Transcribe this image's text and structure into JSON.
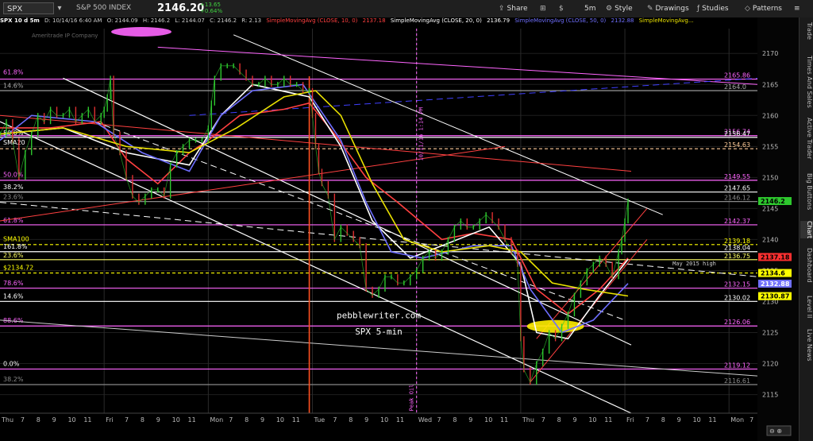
{
  "toolbar": {
    "symbol": "SPX",
    "description": "S&P 500 INDEX",
    "last": "2146.20",
    "change": "+13.65",
    "change_pct": "+0.64%",
    "share": "Share",
    "timeframe": "5m",
    "style": "Style",
    "drawings": "Drawings",
    "studies": "Studies",
    "patterns": "Patterns"
  },
  "studybar": {
    "header": "SPX 10 d 5m",
    "date": "D: 10/14/16 6:40 AM",
    "o": "O: 2144.09",
    "h": "H: 2146.2",
    "l": "L: 2144.07",
    "c": "C: 2146.2",
    "r": "R: 2.13",
    "sma10": "SimpleMovingAvg (CLOSE, 10, 0)",
    "sma10_v": "2137.18",
    "sma20": "SimpleMovingAvg (CLOSE, 20, 0)",
    "sma20_v": "2136.79",
    "sma50": "SimpleMovingAvg (CLOSE, 50, 0)",
    "sma50_v": "2132.88",
    "sma100": "SimpleMovingAvg..."
  },
  "sidebar": [
    "Trade",
    "Times And Sales",
    "Active Trader",
    "Big Buttons",
    "Chart",
    "Dashboard",
    "Level II",
    "Live News"
  ],
  "chart_data": {
    "type": "line",
    "ylim": [
      2112,
      2174
    ],
    "y_ticks": [
      2115,
      2120,
      2125,
      2130,
      2135,
      2140,
      2145,
      2150,
      2155,
      2160,
      2165,
      2170
    ],
    "x_labels": [
      {
        "t": "Thu",
        "x": 0
      },
      {
        "t": "7",
        "x": 6
      },
      {
        "t": "8",
        "x": 11
      },
      {
        "t": "9",
        "x": 16
      },
      {
        "t": "10",
        "x": 21
      },
      {
        "t": "11",
        "x": 26
      },
      {
        "t": "Fri",
        "x": 33
      },
      {
        "t": "7",
        "x": 39
      },
      {
        "t": "8",
        "x": 44
      },
      {
        "t": "9",
        "x": 49
      },
      {
        "t": "10",
        "x": 54
      },
      {
        "t": "11",
        "x": 59
      },
      {
        "t": "Mon",
        "x": 66
      },
      {
        "t": "7",
        "x": 72
      },
      {
        "t": "8",
        "x": 77
      },
      {
        "t": "9",
        "x": 82
      },
      {
        "t": "10",
        "x": 87
      },
      {
        "t": "11",
        "x": 92
      },
      {
        "t": "Tue",
        "x": 99
      },
      {
        "t": "7",
        "x": 105
      },
      {
        "t": "8",
        "x": 110
      },
      {
        "t": "9",
        "x": 115
      },
      {
        "t": "10",
        "x": 120
      },
      {
        "t": "11",
        "x": 125
      },
      {
        "t": "Wed",
        "x": 132
      },
      {
        "t": "7",
        "x": 138
      },
      {
        "t": "8",
        "x": 143
      },
      {
        "t": "9",
        "x": 148
      },
      {
        "t": "10",
        "x": 153
      },
      {
        "t": "11",
        "x": 158
      },
      {
        "t": "Thu",
        "x": 165
      },
      {
        "t": "7",
        "x": 171
      },
      {
        "t": "8",
        "x": 176
      },
      {
        "t": "9",
        "x": 181
      },
      {
        "t": "10",
        "x": 186
      },
      {
        "t": "11",
        "x": 191
      },
      {
        "t": "Fri",
        "x": 198
      },
      {
        "t": "7",
        "x": 204
      },
      {
        "t": "8",
        "x": 209
      },
      {
        "t": "9",
        "x": 214
      },
      {
        "t": "10",
        "x": 219
      },
      {
        "t": "11",
        "x": 224
      },
      {
        "t": "Mon",
        "x": 231
      },
      {
        "t": "7",
        "x": 237
      }
    ],
    "x_max": 240,
    "day_separators": [
      33,
      66,
      99,
      132,
      165,
      198,
      231
    ],
    "price": [
      [
        0,
        2157
      ],
      [
        2,
        2159
      ],
      [
        4,
        2156
      ],
      [
        6,
        2150
      ],
      [
        8,
        2154
      ],
      [
        10,
        2157
      ],
      [
        12,
        2160
      ],
      [
        14,
        2159
      ],
      [
        16,
        2161
      ],
      [
        18,
        2160
      ],
      [
        20,
        2160
      ],
      [
        22,
        2161
      ],
      [
        24,
        2159
      ],
      [
        26,
        2160
      ],
      [
        28,
        2161
      ],
      [
        30,
        2159
      ],
      [
        32,
        2160
      ],
      [
        33,
        2161
      ],
      [
        34,
        2163
      ],
      [
        35,
        2166
      ],
      [
        36,
        2157
      ],
      [
        38,
        2154
      ],
      [
        40,
        2150
      ],
      [
        42,
        2147
      ],
      [
        44,
        2146
      ],
      [
        46,
        2147
      ],
      [
        48,
        2148
      ],
      [
        50,
        2148
      ],
      [
        52,
        2147
      ],
      [
        54,
        2152
      ],
      [
        56,
        2154
      ],
      [
        58,
        2155
      ],
      [
        60,
        2156
      ],
      [
        62,
        2156
      ],
      [
        64,
        2156
      ],
      [
        66,
        2158
      ],
      [
        67,
        2162
      ],
      [
        68,
        2166
      ],
      [
        70,
        2168
      ],
      [
        72,
        2168
      ],
      [
        74,
        2168
      ],
      [
        76,
        2167
      ],
      [
        78,
        2166
      ],
      [
        80,
        2165
      ],
      [
        82,
        2165
      ],
      [
        84,
        2166
      ],
      [
        86,
        2165
      ],
      [
        88,
        2165
      ],
      [
        90,
        2166
      ],
      [
        92,
        2165
      ],
      [
        94,
        2165
      ],
      [
        96,
        2164
      ],
      [
        98,
        2164
      ],
      [
        99,
        2160
      ],
      [
        100,
        2155
      ],
      [
        101,
        2151
      ],
      [
        102,
        2149
      ],
      [
        104,
        2147
      ],
      [
        106,
        2140
      ],
      [
        108,
        2142
      ],
      [
        110,
        2141
      ],
      [
        112,
        2140
      ],
      [
        114,
        2139
      ],
      [
        116,
        2132
      ],
      [
        118,
        2131
      ],
      [
        120,
        2132
      ],
      [
        122,
        2134
      ],
      [
        124,
        2134
      ],
      [
        126,
        2133
      ],
      [
        128,
        2133
      ],
      [
        130,
        2134
      ],
      [
        132,
        2135
      ],
      [
        134,
        2137
      ],
      [
        136,
        2138
      ],
      [
        138,
        2137
      ],
      [
        140,
        2138
      ],
      [
        142,
        2140
      ],
      [
        144,
        2142
      ],
      [
        146,
        2143
      ],
      [
        148,
        2142
      ],
      [
        150,
        2142
      ],
      [
        152,
        2143
      ],
      [
        154,
        2144
      ],
      [
        156,
        2143
      ],
      [
        158,
        2142
      ],
      [
        160,
        2140
      ],
      [
        162,
        2138
      ],
      [
        164,
        2136
      ],
      [
        165,
        2124
      ],
      [
        166,
        2119
      ],
      [
        168,
        2117
      ],
      [
        170,
        2120
      ],
      [
        172,
        2122
      ],
      [
        174,
        2125
      ],
      [
        176,
        2124
      ],
      [
        178,
        2126
      ],
      [
        180,
        2128
      ],
      [
        182,
        2131
      ],
      [
        184,
        2133
      ],
      [
        186,
        2135
      ],
      [
        188,
        2136
      ],
      [
        190,
        2137
      ],
      [
        192,
        2136
      ],
      [
        194,
        2134
      ],
      [
        196,
        2138
      ],
      [
        197,
        2140
      ],
      [
        198,
        2143
      ],
      [
        199,
        2146.2
      ]
    ],
    "smas": [
      {
        "name": "SMA10",
        "color": "#ff4040",
        "pts": [
          [
            0,
            2158
          ],
          [
            16,
            2158
          ],
          [
            32,
            2159
          ],
          [
            40,
            2153
          ],
          [
            50,
            2149
          ],
          [
            60,
            2154
          ],
          [
            66,
            2156
          ],
          [
            76,
            2160
          ],
          [
            90,
            2161
          ],
          [
            98,
            2162
          ],
          [
            106,
            2157
          ],
          [
            116,
            2150
          ],
          [
            126,
            2146
          ],
          [
            140,
            2140
          ],
          [
            150,
            2141
          ],
          [
            162,
            2140
          ],
          [
            170,
            2132
          ],
          [
            180,
            2128
          ],
          [
            190,
            2132
          ],
          [
            199,
            2137
          ]
        ]
      },
      {
        "name": "SMA20",
        "color": "#ffffff",
        "pts": [
          [
            0,
            2157
          ],
          [
            20,
            2158
          ],
          [
            40,
            2154
          ],
          [
            60,
            2152
          ],
          [
            70,
            2160
          ],
          [
            80,
            2165
          ],
          [
            98,
            2163
          ],
          [
            108,
            2155
          ],
          [
            118,
            2143
          ],
          [
            130,
            2137
          ],
          [
            140,
            2139
          ],
          [
            155,
            2142
          ],
          [
            165,
            2136
          ],
          [
            170,
            2125
          ],
          [
            180,
            2124
          ],
          [
            190,
            2131
          ],
          [
            199,
            2136.8
          ]
        ]
      },
      {
        "name": "SMA50",
        "color": "#6e6eff",
        "pts": [
          [
            0,
            2156
          ],
          [
            10,
            2160
          ],
          [
            30,
            2159
          ],
          [
            45,
            2154
          ],
          [
            60,
            2151
          ],
          [
            70,
            2160
          ],
          [
            80,
            2164
          ],
          [
            96,
            2165
          ],
          [
            108,
            2156
          ],
          [
            116,
            2146
          ],
          [
            124,
            2138
          ],
          [
            134,
            2137
          ],
          [
            150,
            2139
          ],
          [
            162,
            2139
          ],
          [
            168,
            2132
          ],
          [
            178,
            2125
          ],
          [
            188,
            2127
          ],
          [
            199,
            2132.9
          ]
        ]
      },
      {
        "name": "SMA100",
        "color": "#e8e000",
        "pts": [
          [
            0,
            2157
          ],
          [
            20,
            2158
          ],
          [
            40,
            2155
          ],
          [
            60,
            2154
          ],
          [
            75,
            2158
          ],
          [
            90,
            2163
          ],
          [
            100,
            2164
          ],
          [
            108,
            2160
          ],
          [
            118,
            2149
          ],
          [
            128,
            2140
          ],
          [
            140,
            2138
          ],
          [
            155,
            2139
          ],
          [
            165,
            2138
          ],
          [
            175,
            2133
          ],
          [
            185,
            2132
          ],
          [
            199,
            2130.9
          ]
        ]
      }
    ],
    "h_levels": [
      {
        "y": 2165.86,
        "color": "#ff66ff",
        "label": "2165.86",
        "dash": false
      },
      {
        "y": 2164.0,
        "color": "#aaaaaa",
        "label": "2164.0",
        "dash": false
      },
      {
        "y": 2156.74,
        "color": "#ff66ff",
        "label": "2156.74",
        "dash": false
      },
      {
        "y": 2156.47,
        "color": "#ffffff",
        "label": "2156.47",
        "dash": false
      },
      {
        "y": 2154.63,
        "color": "#ffcc99",
        "label": "2154.63",
        "dash": true
      },
      {
        "y": 2149.55,
        "color": "#ff66ff",
        "label": "2149.55",
        "dash": false
      },
      {
        "y": 2147.65,
        "color": "#ffffff",
        "label": "2147.65",
        "dash": false
      },
      {
        "y": 2146.12,
        "color": "#888888",
        "label": "2146.12",
        "dash": false
      },
      {
        "y": 2142.37,
        "color": "#ff66ff",
        "label": "2142.37",
        "dash": false
      },
      {
        "y": 2139.18,
        "color": "#ffff00",
        "label": "2139.18",
        "dash": true
      },
      {
        "y": 2138.04,
        "color": "#ffffff",
        "label": "2138.04",
        "dash": false
      },
      {
        "y": 2136.75,
        "color": "#ffff66",
        "label": "2136.75",
        "dash": false
      },
      {
        "y": 2134.6,
        "color": "#ffff00",
        "label": "",
        "dash": true
      },
      {
        "y": 2132.15,
        "color": "#ff66ff",
        "label": "2132.15",
        "dash": false
      },
      {
        "y": 2130.02,
        "color": "#ffffff",
        "label": "2130.02",
        "dash": false
      },
      {
        "y": 2126.06,
        "color": "#ff66ff",
        "label": "2126.06",
        "dash": false
      },
      {
        "y": 2119.12,
        "color": "#ff66ff",
        "label": "2119.12",
        "dash": false
      },
      {
        "y": 2116.61,
        "color": "#888888",
        "label": "2116.61",
        "dash": false
      }
    ],
    "left_labels": [
      {
        "y": 2166.5,
        "t": "61.8%",
        "color": "#ff66ff"
      },
      {
        "y": 2164.3,
        "t": "14.6%",
        "color": "#aaaaaa"
      },
      {
        "y": 2156.7,
        "t": "50.0%",
        "color": "#ffffff"
      },
      {
        "y": 2155.2,
        "t": "SMA20",
        "color": "#ffffff"
      },
      {
        "y": 2150.0,
        "t": "50.0%",
        "color": "#ff66ff"
      },
      {
        "y": 2148.0,
        "t": "38.2%",
        "color": "#ffffff"
      },
      {
        "y": 2146.4,
        "t": "23.6%",
        "color": "#888888"
      },
      {
        "y": 2142.6,
        "t": "61.8%",
        "color": "#ff66ff"
      },
      {
        "y": 2139.6,
        "t": "SMA100",
        "color": "#ffff00"
      },
      {
        "y": 2138.4,
        "t": "161.8%",
        "color": "#ffffff"
      },
      {
        "y": 2137.0,
        "t": "23.6%",
        "color": "#ffff66"
      },
      {
        "y": 2135.0,
        "t": "$2134.72",
        "color": "#ffff00"
      },
      {
        "y": 2132.5,
        "t": "78.6%",
        "color": "#ff66ff"
      },
      {
        "y": 2130.4,
        "t": "14.6%",
        "color": "#ffffff"
      },
      {
        "y": 2126.5,
        "t": "88.6%",
        "color": "#ff66ff"
      },
      {
        "y": 2119.5,
        "t": "0.0%",
        "color": "#ffffff"
      },
      {
        "y": 2117.0,
        "t": "38.2%",
        "color": "#888888"
      }
    ],
    "badges": [
      {
        "y": 2146.2,
        "label": "2146.2",
        "bg": "#2ec82e",
        "fg": "#000"
      },
      {
        "y": 2137.18,
        "label": "2137.18",
        "bg": "#ff3030",
        "fg": "#000"
      },
      {
        "y": 2134.6,
        "label": "2134.6",
        "bg": "#ffff00",
        "fg": "#000"
      },
      {
        "y": 2132.88,
        "label": "2132.88",
        "bg": "#7070ff",
        "fg": "#fff"
      },
      {
        "y": 2130.87,
        "label": "2130.87",
        "bg": "#ffff00",
        "fg": "#000"
      }
    ],
    "trendlines": [
      {
        "x1": 0,
        "y1": 2159,
        "x2": 200,
        "y2": 2112,
        "color": "#ffffff",
        "w": 1.2,
        "dash": false
      },
      {
        "x1": 20,
        "y1": 2166,
        "x2": 200,
        "y2": 2123,
        "color": "#ffffff",
        "w": 1.2,
        "dash": false
      },
      {
        "x1": 74,
        "y1": 2173,
        "x2": 210,
        "y2": 2144,
        "color": "#ffffff",
        "w": 1,
        "dash": false
      },
      {
        "x1": 50,
        "y1": 2171,
        "x2": 240,
        "y2": 2165,
        "color": "#ff66ff",
        "w": 1,
        "dash": false
      },
      {
        "x1": 0,
        "y1": 2146,
        "x2": 240,
        "y2": 2134,
        "color": "#ffffff",
        "w": 1,
        "dash": true
      },
      {
        "x1": 30,
        "y1": 2159,
        "x2": 198,
        "y2": 2127,
        "color": "#ffffff",
        "w": 1,
        "dash": true
      },
      {
        "x1": 0,
        "y1": 2160,
        "x2": 200,
        "y2": 2151,
        "color": "#ff4040",
        "w": 1,
        "dash": false
      },
      {
        "x1": 0,
        "y1": 2143,
        "x2": 160,
        "y2": 2155,
        "color": "#ff4040",
        "w": 1,
        "dash": false
      },
      {
        "x1": 0,
        "y1": 2127,
        "x2": 240,
        "y2": 2118,
        "color": "#cccccc",
        "w": 1,
        "dash": false
      },
      {
        "x1": 60,
        "y1": 2160,
        "x2": 240,
        "y2": 2166,
        "color": "#4040ff",
        "w": 1,
        "dash": true
      },
      {
        "x1": 168,
        "y1": 2117,
        "x2": 205,
        "y2": 2140,
        "color": "#ff4040",
        "w": 1,
        "dash": false
      },
      {
        "x1": 170,
        "y1": 2124,
        "x2": 205,
        "y2": 2145,
        "color": "#ff4040",
        "w": 1,
        "dash": false
      }
    ],
    "red_vline_x": 98,
    "marker_vline_x": 132,
    "annotations": [
      {
        "t": "pebblewriter.com",
        "x": 120,
        "y": 2127.3,
        "color": "#ffffff",
        "size": 11
      },
      {
        "t": "SPX 5-min",
        "x": 120,
        "y": 2124.7,
        "color": "#ffffff",
        "size": 11
      },
      {
        "t": "May 2015 high",
        "x": 220,
        "y": 2135.8,
        "color": "#cccccc",
        "size": 7
      },
      {
        "t": "Peak Oil",
        "x": 131,
        "y": 2114.5,
        "color": "#ff66ff",
        "size": 7,
        "rotate": true
      },
      {
        "t": "10/11/16 1:14 PM",
        "x": 134,
        "y": 2157,
        "color": "#ff66ff",
        "size": 7,
        "rotate": true
      }
    ],
    "broker": "Ameritrade IP Company"
  }
}
